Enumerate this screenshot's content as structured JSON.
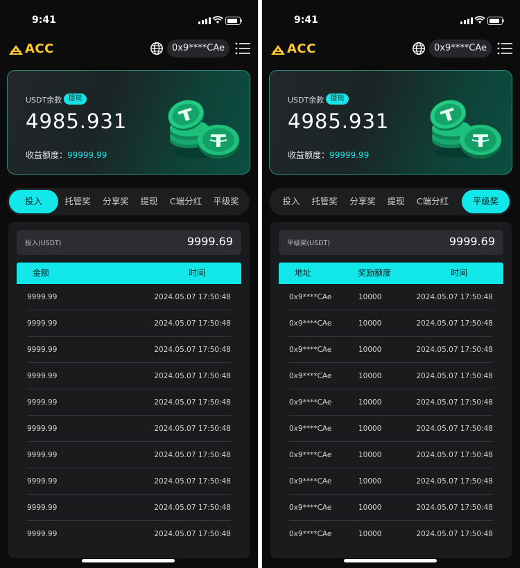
{
  "status": {
    "time": "9:41"
  },
  "header": {
    "app_name": "ACC",
    "address": "0x9****CAe"
  },
  "balance_card": {
    "label": "USDT余款",
    "withdraw_label": "提现",
    "balance": "4985.931",
    "quota_label": "收益额度：",
    "quota_value": "99999.99"
  },
  "tabs": [
    "投入",
    "托管奖",
    "分享奖",
    "提现",
    "C端分红",
    "平级奖"
  ],
  "left_screen": {
    "active_tab": "投入",
    "summary_label": "投入(USDT)",
    "summary_value": "9999.69",
    "columns": [
      "金额",
      "时间"
    ],
    "rows": [
      [
        "9999.99",
        "2024.05.07 17:50:48"
      ],
      [
        "9999.99",
        "2024.05.07 17:50:48"
      ],
      [
        "9999.99",
        "2024.05.07 17:50:48"
      ],
      [
        "9999.99",
        "2024.05.07 17:50:48"
      ],
      [
        "9999.99",
        "2024.05.07 17:50:48"
      ],
      [
        "9999.99",
        "2024.05.07 17:50:48"
      ],
      [
        "9999.99",
        "2024.05.07 17:50:48"
      ],
      [
        "9999.99",
        "2024.05.07 17:50:48"
      ],
      [
        "9999.99",
        "2024.05.07 17:50:48"
      ],
      [
        "9999.99",
        "2024.05.07 17:50:48"
      ]
    ]
  },
  "right_screen": {
    "active_tab": "平级奖",
    "summary_label": "平级奖(USDT)",
    "summary_value": "9999.69",
    "columns": [
      "地址",
      "奖励额度",
      "时间"
    ],
    "rows": [
      [
        "0x9****CAe",
        "10000",
        "2024.05.07 17:50:48"
      ],
      [
        "0x9****CAe",
        "10000",
        "2024.05.07 17:50:48"
      ],
      [
        "0x9****CAe",
        "10000",
        "2024.05.07 17:50:48"
      ],
      [
        "0x9****CAe",
        "10000",
        "2024.05.07 17:50:48"
      ],
      [
        "0x9****CAe",
        "10000",
        "2024.05.07 17:50:48"
      ],
      [
        "0x9****CAe",
        "10000",
        "2024.05.07 17:50:48"
      ],
      [
        "0x9****CAe",
        "10000",
        "2024.05.07 17:50:48"
      ],
      [
        "0x9****CAe",
        "10000",
        "2024.05.07 17:50:48"
      ],
      [
        "0x9****CAe",
        "10000",
        "2024.05.07 17:50:48"
      ],
      [
        "0x9****CAe",
        "10000",
        "2024.05.07 17:50:48"
      ]
    ]
  },
  "icons": [
    "signal-icon",
    "wifi-icon",
    "battery-icon",
    "acc-logo-icon",
    "globe-icon",
    "menu-icon",
    "usdt-coins-icon"
  ],
  "colors": {
    "accent": "#12e7ea",
    "logo": "#ffc92e",
    "background": "#0c0c0d",
    "panel": "#1a1b1d"
  }
}
